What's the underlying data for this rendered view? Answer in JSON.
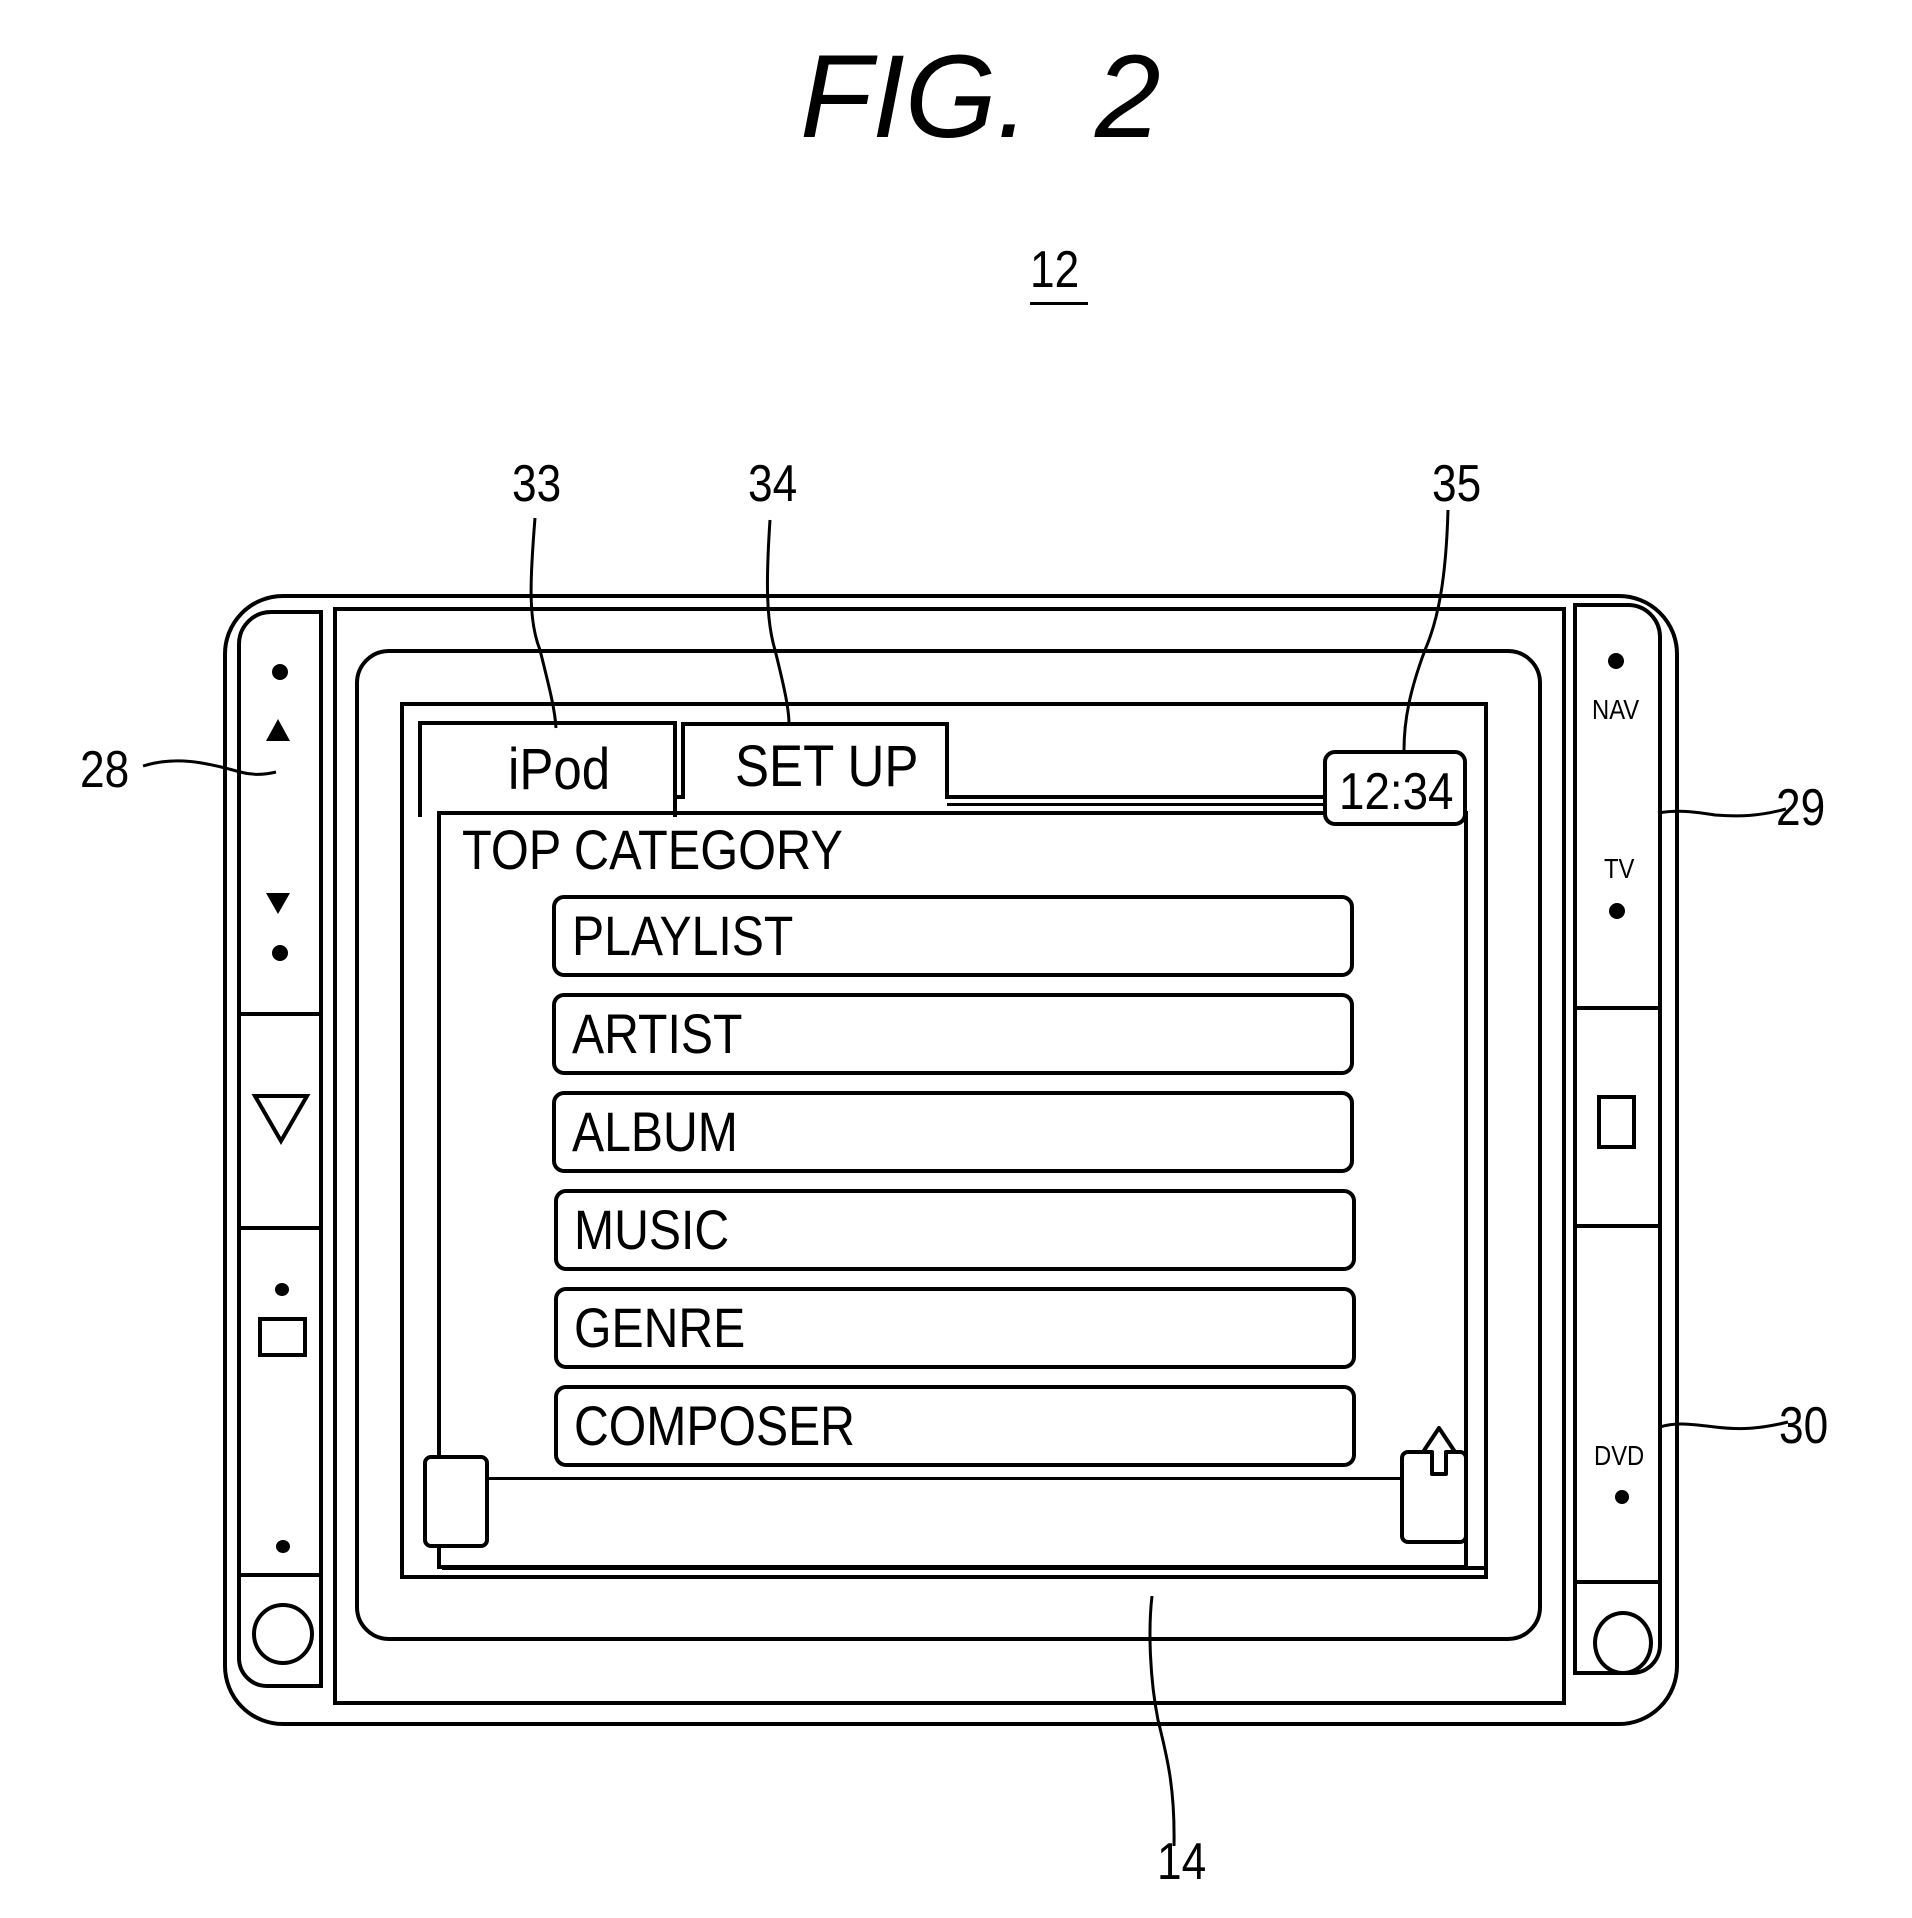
{
  "figure": {
    "title": "FIG.  2",
    "device_ref": "12"
  },
  "reference_labels": {
    "left_switch_panel": "28",
    "right_top_switch_panel": "29",
    "right_bottom_switch_panel": "30",
    "ipod_tab": "33",
    "setup_tab": "34",
    "clock": "35",
    "display": "14"
  },
  "screen": {
    "tabs": [
      {
        "label": "iPod",
        "active": true
      },
      {
        "label": "SET UP",
        "active": false
      }
    ],
    "clock": "12:34",
    "heading": "TOP CATEGORY",
    "menu_items": [
      {
        "label": "PLAYLIST"
      },
      {
        "label": "ARTIST"
      },
      {
        "label": "ALBUM"
      },
      {
        "label": "MUSIC"
      },
      {
        "label": "GENRE"
      },
      {
        "label": "COMPOSER"
      }
    ],
    "scroll_left_icon": "blank-button",
    "scroll_right_icon": "up-arrow-icon"
  },
  "left_panel": {
    "icons": [
      "up-triangle-icon",
      "down-triangle-icon",
      "down-outline-triangle-icon",
      "square-icon",
      "knob-icon"
    ]
  },
  "right_panel": {
    "labels": {
      "nav": "NAV",
      "tv": "TV",
      "dvd": "DVD"
    },
    "icons": [
      "rectangle-icon",
      "knob-icon"
    ]
  }
}
